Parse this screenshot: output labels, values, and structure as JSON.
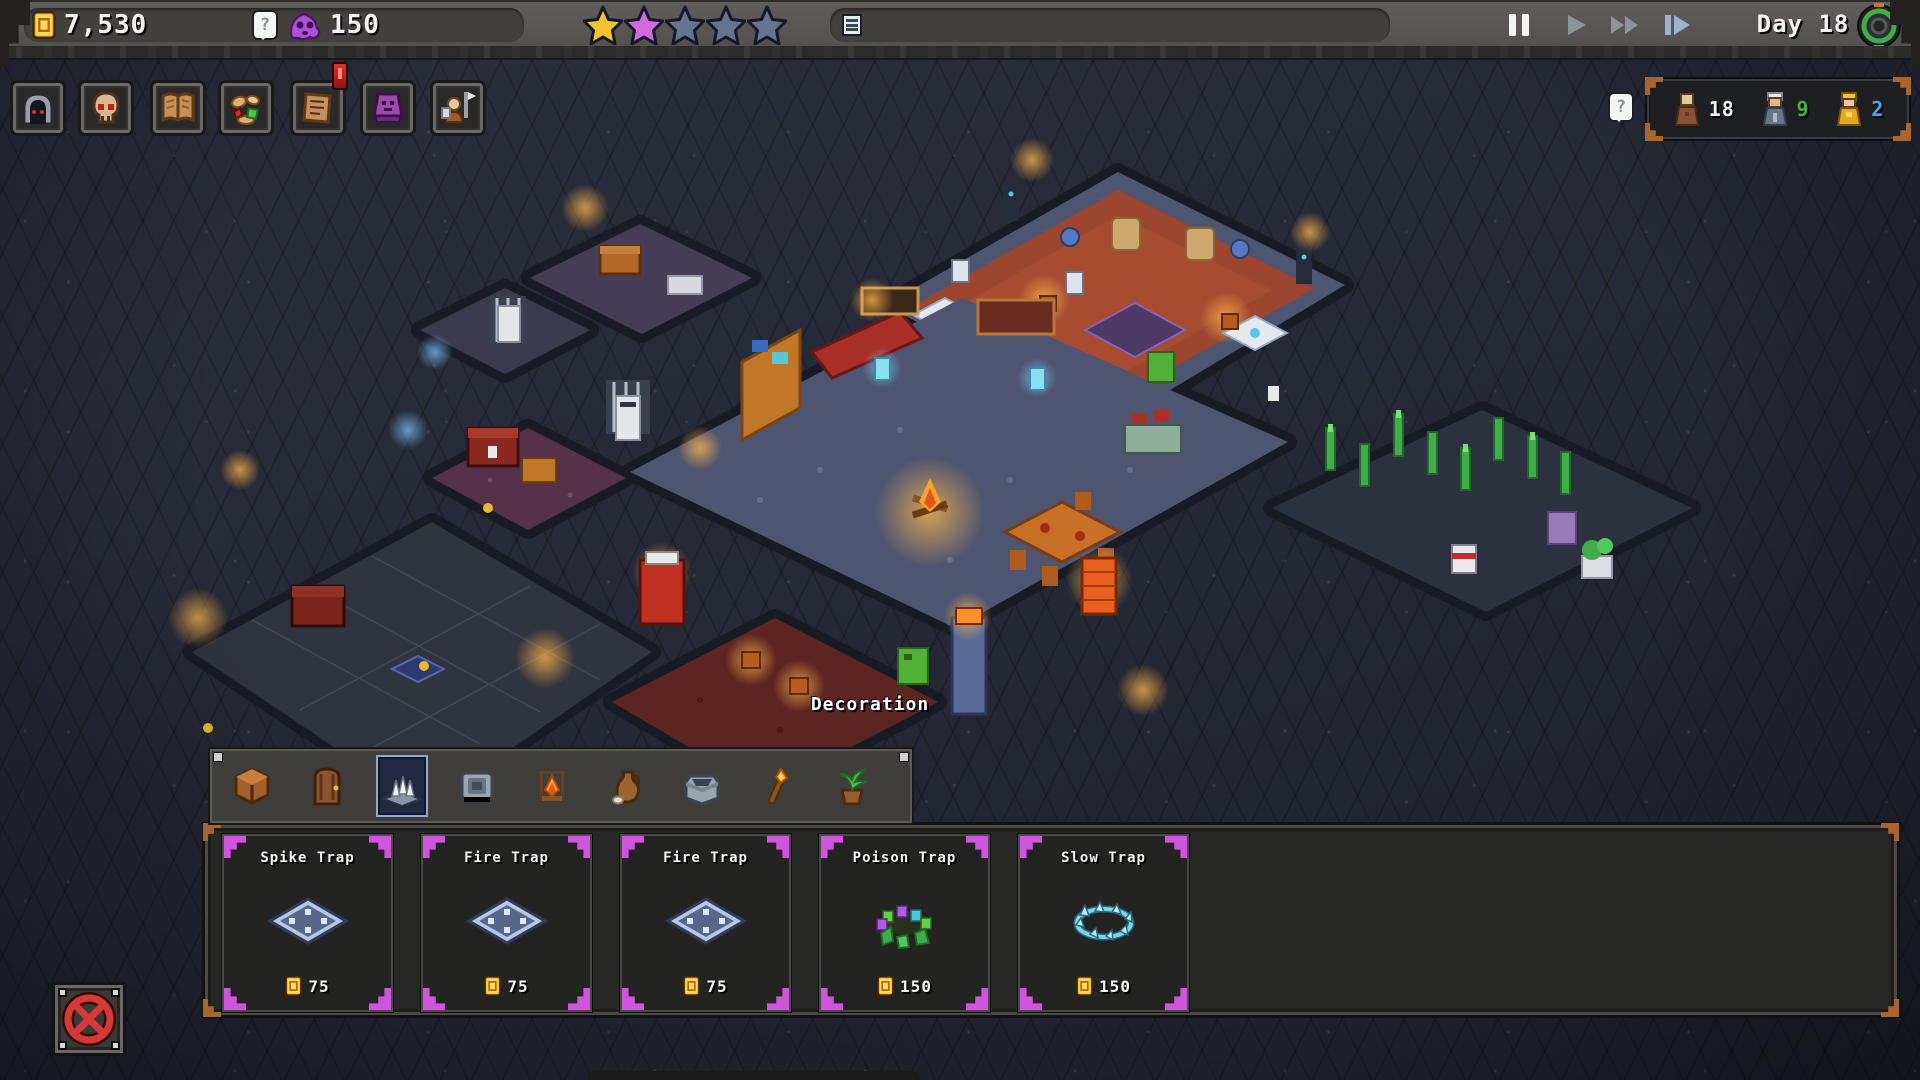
{
  "topbar": {
    "gold": "7,530",
    "mana": "150",
    "day": "Day 18",
    "question_mark": "?",
    "stars": [
      {
        "color": "#f2c232"
      },
      {
        "color": "#d36ae0"
      },
      {
        "color": "#67748f"
      },
      {
        "color": "#67748f"
      },
      {
        "color": "#67748f"
      }
    ],
    "message_bar": {
      "icon": "log-icon",
      "text": ""
    },
    "playback": [
      {
        "icon": "pause-icon",
        "active": true
      },
      {
        "icon": "play-icon",
        "active": false
      },
      {
        "icon": "fast-forward-icon",
        "active": false
      },
      {
        "icon": "skip-icon",
        "active": false
      }
    ],
    "settings_icon": "settings-ring-icon"
  },
  "toolbar": {
    "items": [
      {
        "icon": "dungeon-gate-icon"
      },
      {
        "icon": "skull-icon"
      },
      {
        "icon": "book-icon"
      },
      {
        "icon": "loot-pile-icon"
      },
      {
        "icon": "notice-scroll-icon",
        "badge": "!"
      },
      {
        "icon": "purple-altar-icon"
      },
      {
        "icon": "hero-flag-icon"
      }
    ]
  },
  "population": {
    "question_mark": "?",
    "entries": [
      {
        "icon": "worker-brown-icon",
        "count": "18",
        "color": "#f2f2f2"
      },
      {
        "icon": "elder-grey-icon",
        "count": "9",
        "color": "#47b04b"
      },
      {
        "icon": "hero-gold-icon",
        "count": "2",
        "color": "#4aa8e8"
      }
    ]
  },
  "scene": {
    "tooltip": "Decoration"
  },
  "build_menu": {
    "tabs": [
      {
        "icon": "crate-icon",
        "selected": false
      },
      {
        "icon": "door-icon",
        "selected": false
      },
      {
        "icon": "spike-trap-tab-icon",
        "selected": true
      },
      {
        "icon": "pressure-plate-icon",
        "selected": false
      },
      {
        "icon": "campfire-icon",
        "selected": false
      },
      {
        "icon": "jug-icon",
        "selected": false
      },
      {
        "icon": "furnace-icon",
        "selected": false
      },
      {
        "icon": "torch-icon",
        "selected": false
      },
      {
        "icon": "plant-icon",
        "selected": false
      }
    ],
    "items": [
      {
        "name": "Spike Trap",
        "price": "75",
        "icon": "spike-trap-icon"
      },
      {
        "name": "Fire Trap",
        "price": "75",
        "icon": "fire-trap-icon"
      },
      {
        "name": "Fire Trap",
        "price": "75",
        "icon": "fire-trap-icon"
      },
      {
        "name": "Poison Trap",
        "price": "150",
        "icon": "poison-trap-icon"
      },
      {
        "name": "Slow Trap",
        "price": "150",
        "icon": "slow-trap-icon"
      }
    ]
  },
  "close_button": {
    "icon": "cancel-icon"
  },
  "colors": {
    "accent_magenta": "#cf55dd",
    "gold_coin": "#f0a828",
    "bronze_corner": "#a8652f",
    "star_gold": "#f2c232",
    "star_purple": "#d36ae0",
    "star_empty": "#67748f",
    "count_green": "#47b04b",
    "count_blue": "#4aa8e8"
  }
}
